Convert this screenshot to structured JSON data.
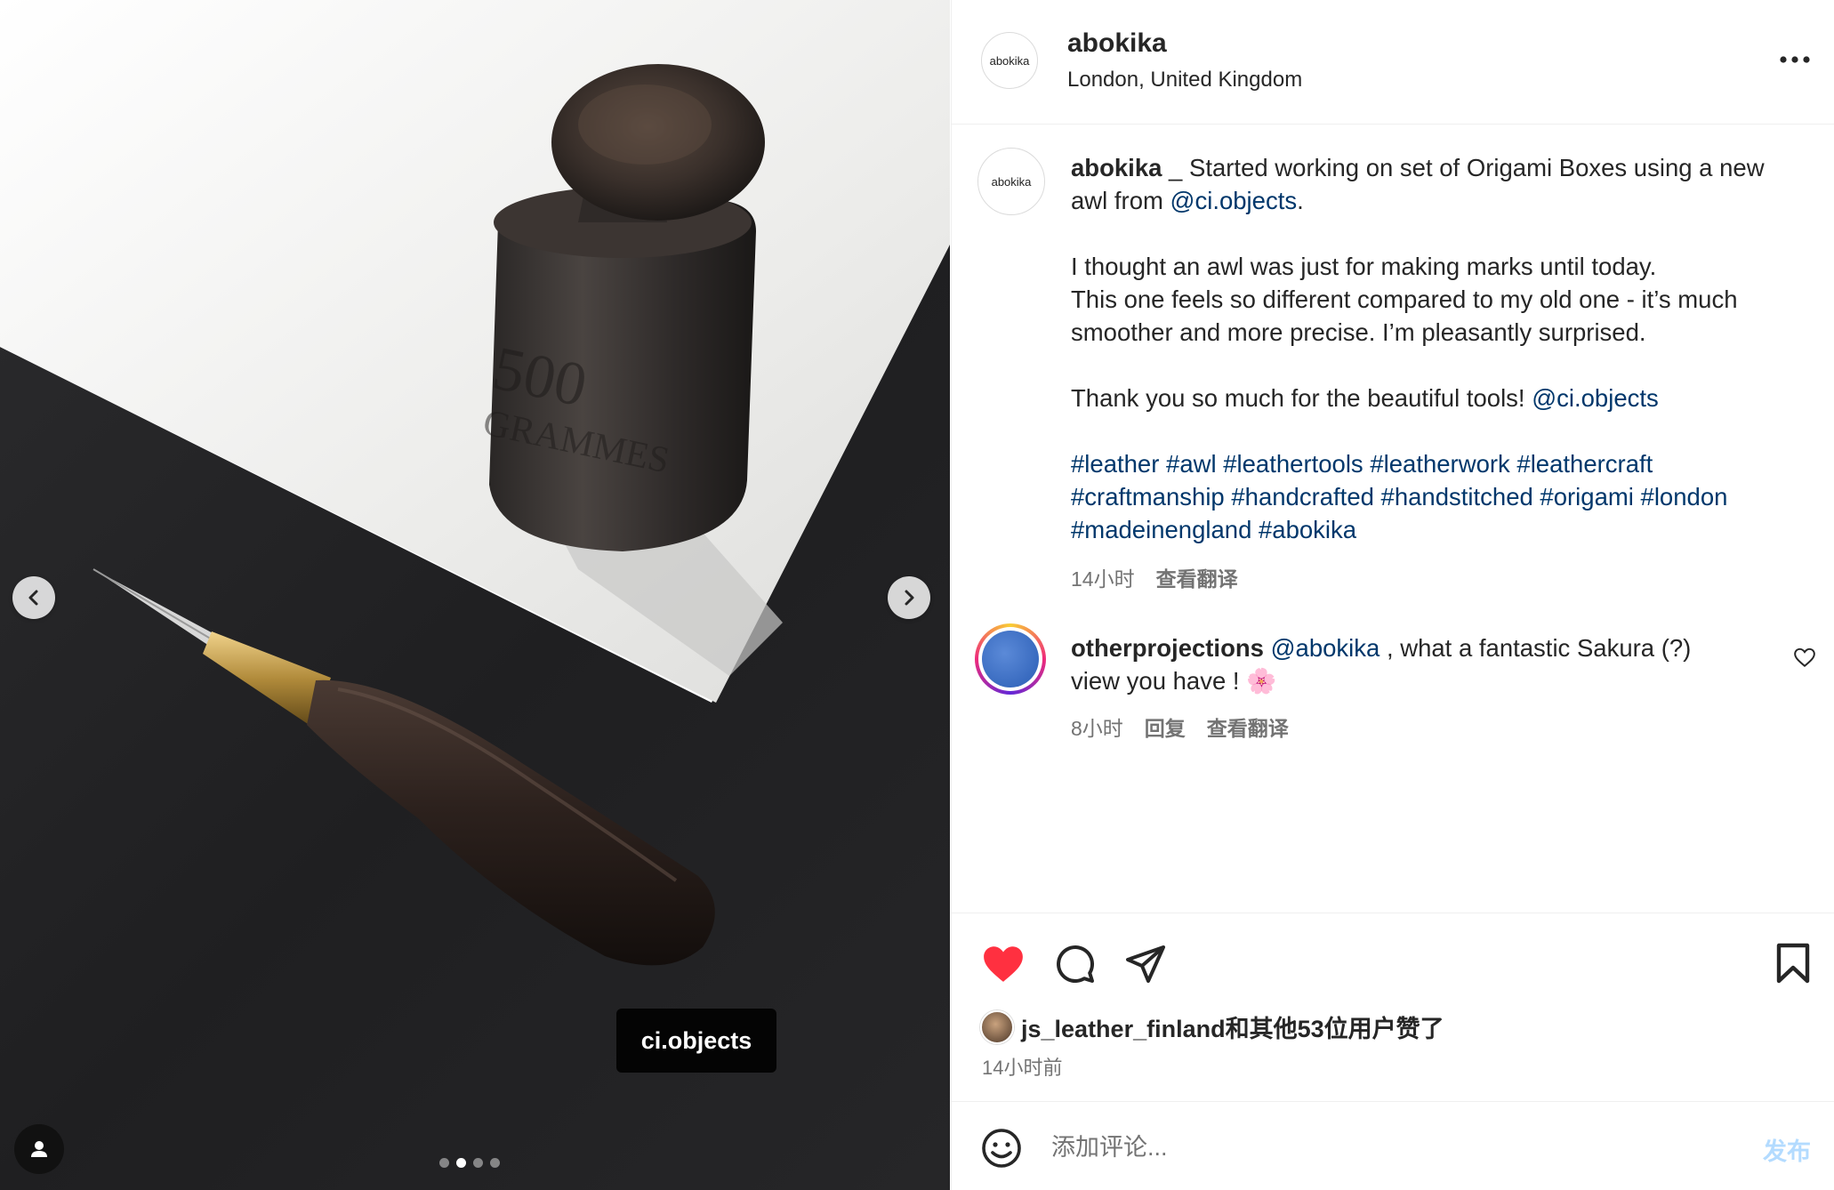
{
  "colors": {
    "link": "#00376b",
    "like_red": "#ff3040",
    "muted": "#737373",
    "post_button_disabled": "#b3dbff"
  },
  "media": {
    "tag_label": "ci.objects",
    "carousel": {
      "count": 4,
      "active_index": 1
    },
    "icons": [
      "chevron-left-icon",
      "chevron-right-icon",
      "user-tag-icon"
    ]
  },
  "header": {
    "avatar_text": "abokika",
    "username": "abokika",
    "location": "London, United Kingdom"
  },
  "caption": {
    "avatar_text": "abokika",
    "username": "abokika",
    "line1_text": " _ Started working on set of Origami Boxes using a new awl from ",
    "line1_mention": "@ci.objects",
    "line1_end": ".",
    "para2_line1": "I thought an awl was just for making marks until today.",
    "para2_line2": "This one feels so different compared to my old one - it’s much smoother and more precise. I’m pleasantly surprised.",
    "para3_text": "Thank you so much for the beautiful tools! ",
    "para3_mention": "@ci.objects",
    "hashtags": "#leather #awl #leathertools #leatherwork #leathercraft #craftmanship #handcrafted #handstitched #origami #london #madeinengland #abokika",
    "time": "14小时",
    "translate": "查看翻译"
  },
  "comment": {
    "username": "otherprojections",
    "mention": "@abokika",
    "text": " , what a fantastic Sakura (?) view you have ! 🌸",
    "time": "8小时",
    "reply": "回复",
    "translate": "查看翻译"
  },
  "actions": {
    "icons": [
      "heart-filled-icon",
      "comment-icon",
      "share-icon",
      "bookmark-icon"
    ],
    "liked": true,
    "likes_text": "js_leather_finland和其他53位用户赞了",
    "post_time": "14小时前"
  },
  "comment_box": {
    "placeholder": "添加评论...",
    "post_label": "发布"
  }
}
